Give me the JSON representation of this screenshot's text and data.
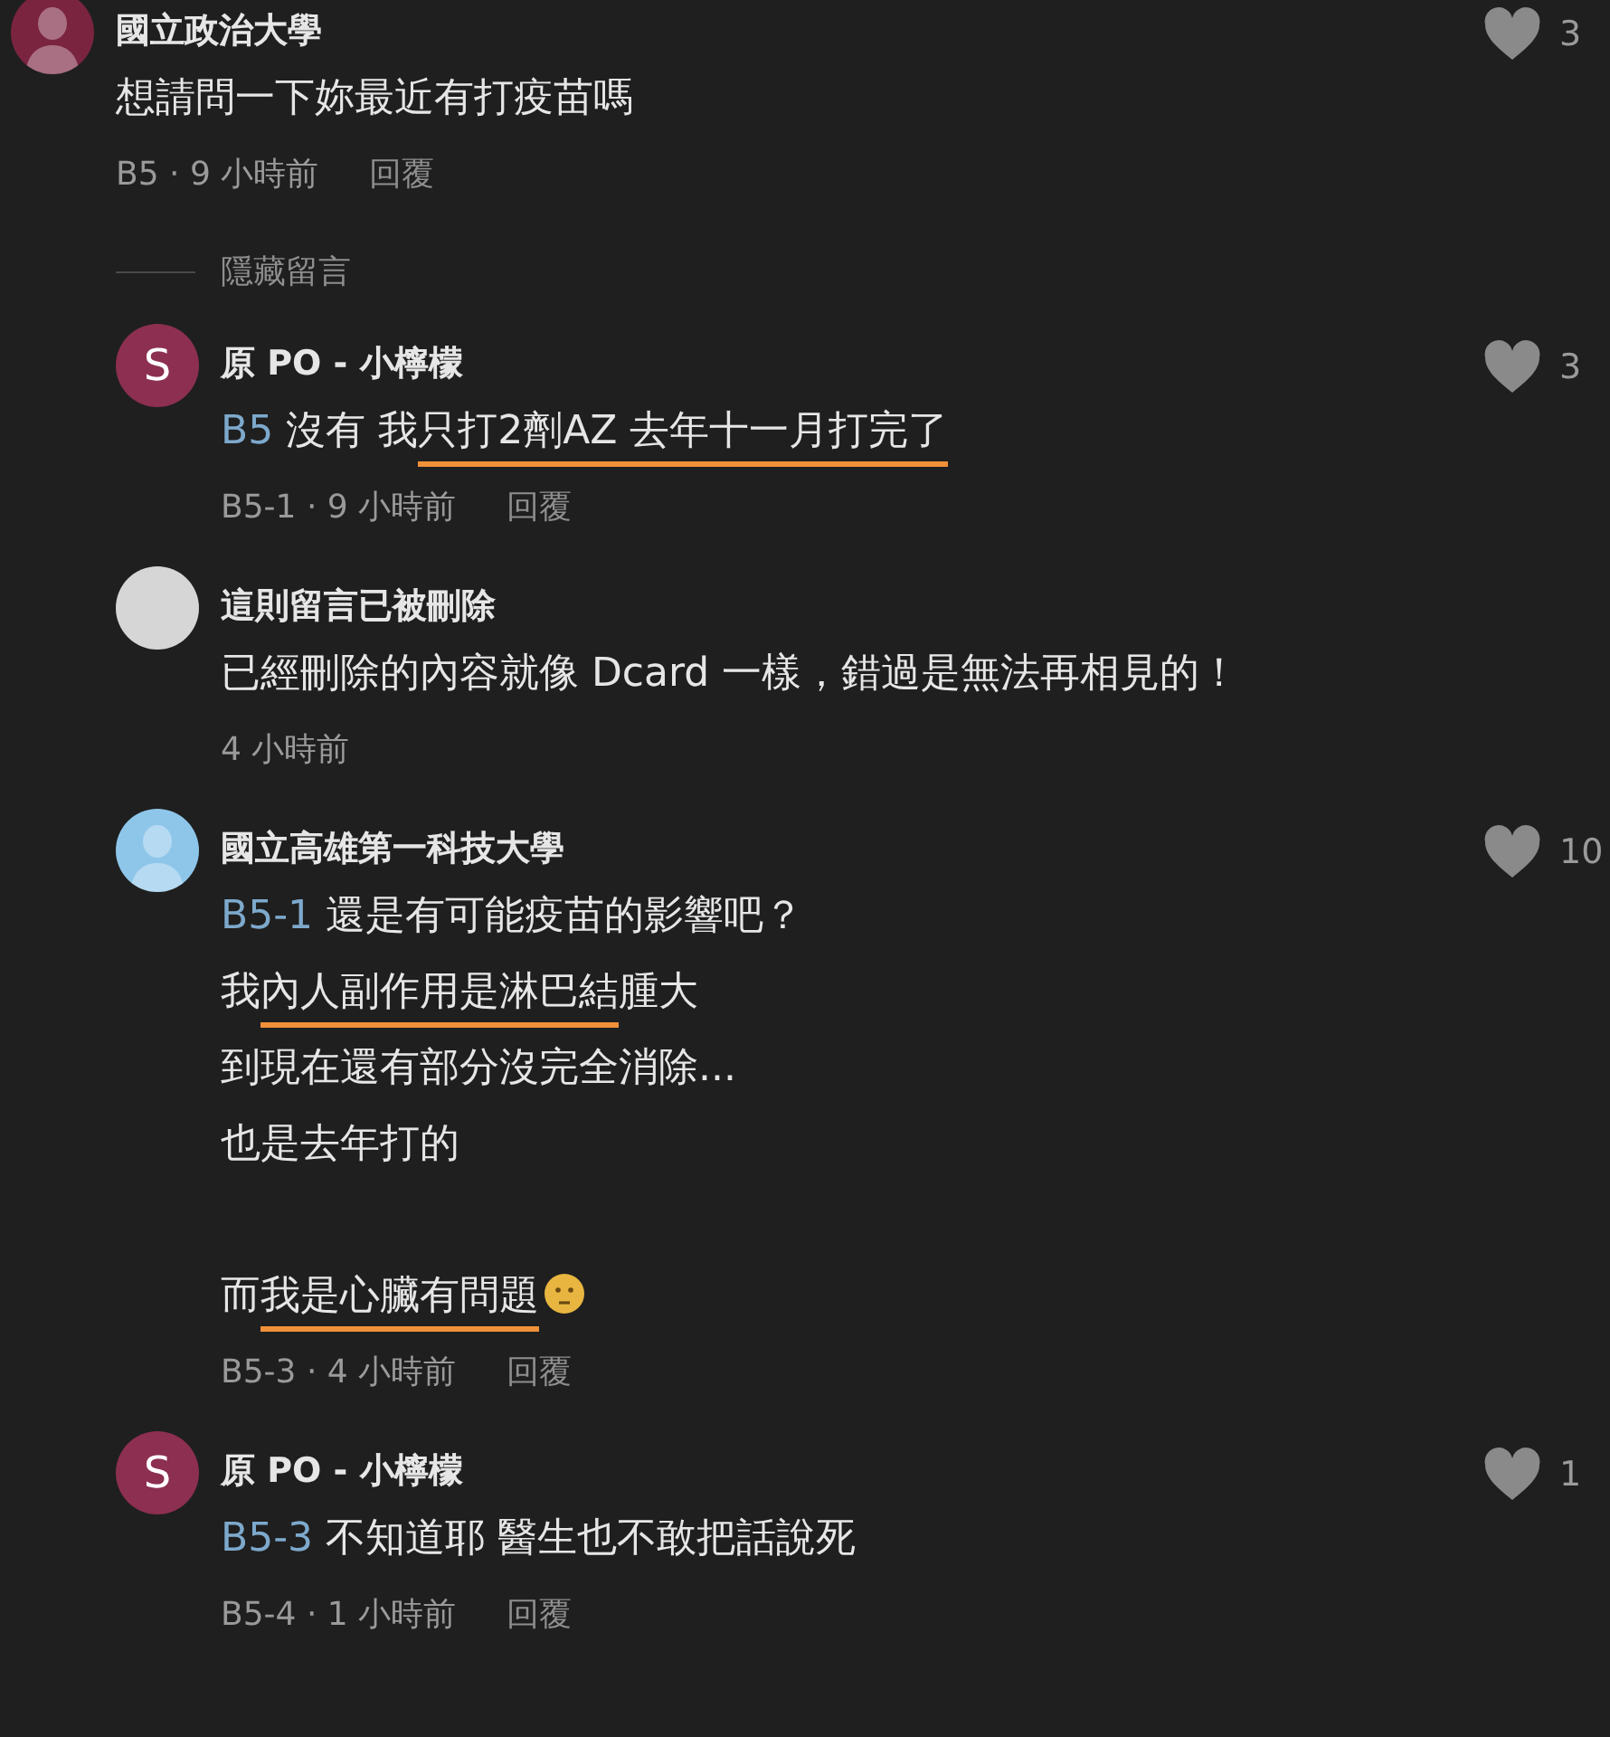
{
  "comments": [
    {
      "avatar": {
        "kind": "figure",
        "color": "#7a2440"
      },
      "author": "國立政治大學",
      "likes": "3",
      "lines": [
        {
          "kind": "text",
          "segments": [
            {
              "kind": "text",
              "text": "想請問一下妳最近有打疫苗嗎",
              "underlined": false
            }
          ]
        }
      ],
      "time": "B5 · 9 小時前",
      "reply": "回覆",
      "hide_toggle": "隱藏留言",
      "children": [
        {
          "avatar": {
            "kind": "letter",
            "letter": "S",
            "color": "#8c2f50"
          },
          "author": "原 PO - 小檸檬",
          "likes": "3",
          "lines": [
            {
              "kind": "text",
              "segments": [
                {
                  "kind": "ref",
                  "text": "B5"
                },
                {
                  "kind": "text",
                  "text": " 沒有 我",
                  "underlined": false
                },
                {
                  "kind": "text",
                  "text": "只打2劑AZ 去年十一月打完了",
                  "underlined": true
                }
              ]
            }
          ],
          "time": "B5-1 · 9 小時前",
          "reply": "回覆"
        },
        {
          "avatar": {
            "kind": "blank",
            "color": "#d6d6d6"
          },
          "author": "這則留言已被刪除",
          "lines": [
            {
              "kind": "text",
              "segments": [
                {
                  "kind": "text",
                  "text": "已經刪除的內容就像 Dcard 一樣，錯過是無法再相見的！",
                  "underlined": false
                }
              ]
            }
          ],
          "time": "4 小時前"
        },
        {
          "avatar": {
            "kind": "figure",
            "color": "#8ec6ea"
          },
          "author": "國立高雄第一科技大學",
          "likes": "10",
          "lines": [
            {
              "kind": "text",
              "segments": [
                {
                  "kind": "ref",
                  "text": "B5-1"
                },
                {
                  "kind": "text",
                  "text": " 還是有可能疫苗的影響吧？",
                  "underlined": false
                }
              ]
            },
            {
              "kind": "text",
              "segments": [
                {
                  "kind": "text",
                  "text": "我",
                  "underlined": false
                },
                {
                  "kind": "text",
                  "text": "內人副作用是淋巴結",
                  "underlined": true
                },
                {
                  "kind": "text",
                  "text": "腫大",
                  "underlined": false
                }
              ]
            },
            {
              "kind": "text",
              "segments": [
                {
                  "kind": "text",
                  "text": "到現在還有部分沒完全消除...",
                  "underlined": false
                }
              ]
            },
            {
              "kind": "text",
              "segments": [
                {
                  "kind": "text",
                  "text": "也是去年打的",
                  "underlined": false
                }
              ]
            },
            {
              "kind": "blank"
            },
            {
              "kind": "text",
              "segments": [
                {
                  "kind": "text",
                  "text": "而",
                  "underlined": false
                },
                {
                  "kind": "text",
                  "text": "我是心臟有問題",
                  "underlined": true
                },
                {
                  "kind": "emoji"
                }
              ]
            }
          ],
          "time": "B5-3 · 4 小時前",
          "reply": "回覆"
        },
        {
          "avatar": {
            "kind": "letter",
            "letter": "S",
            "color": "#8c2f50"
          },
          "author": "原 PO - 小檸檬",
          "likes": "1",
          "lines": [
            {
              "kind": "text",
              "segments": [
                {
                  "kind": "ref",
                  "text": "B5-3"
                },
                {
                  "kind": "text",
                  "text": " 不知道耶 醫生也不敢把話說死",
                  "underlined": false
                }
              ]
            }
          ],
          "time": "B5-4 · 1 小時前",
          "reply": "回覆"
        }
      ]
    }
  ]
}
